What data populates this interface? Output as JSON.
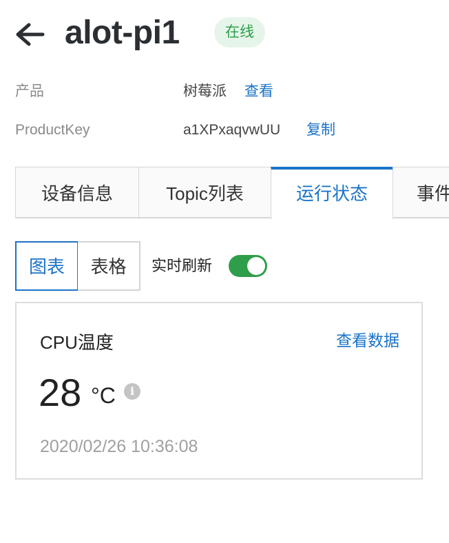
{
  "header": {
    "title": "alot-pi1",
    "status_badge": "在线",
    "back_icon": "arrow-left-icon"
  },
  "info": {
    "product_label": "产品",
    "product_value": "树莓派",
    "product_link": "查看",
    "productkey_label": "ProductKey",
    "productkey_value": "a1XPxaqvwUU",
    "productkey_link": "复制"
  },
  "tabs": [
    {
      "label": "设备信息",
      "active": false
    },
    {
      "label": "Topic列表",
      "active": false
    },
    {
      "label": "运行状态",
      "active": true
    },
    {
      "label": "事件",
      "active": false
    }
  ],
  "view_toggle": {
    "chart_label": "图表",
    "table_label": "表格",
    "selected": "图表"
  },
  "realtime": {
    "label": "实时刷新",
    "enabled": true
  },
  "metric_card": {
    "title": "CPU温度",
    "view_data_link": "查看数据",
    "value": "28",
    "unit": "°C",
    "info_icon": "info-icon",
    "timestamp": "2020/02/26 10:36:08"
  },
  "colors": {
    "accent": "#1a73c7",
    "success": "#2e9e4a",
    "badge_bg": "#e6f5ea"
  }
}
